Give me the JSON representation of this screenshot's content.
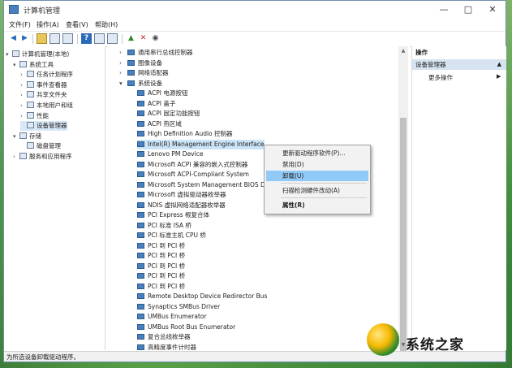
{
  "window": {
    "title": "计算机管理"
  },
  "menu": [
    "文件(F)",
    "操作(A)",
    "查看(V)",
    "帮助(H)"
  ],
  "left_tree": [
    {
      "label": "计算机管理(本地)",
      "indent": 0,
      "arrow": "▾"
    },
    {
      "label": "系统工具",
      "indent": 1,
      "arrow": "▾"
    },
    {
      "label": "任务计划程序",
      "indent": 2,
      "arrow": "›"
    },
    {
      "label": "事件查看器",
      "indent": 2,
      "arrow": "›"
    },
    {
      "label": "共享文件夹",
      "indent": 2,
      "arrow": "›"
    },
    {
      "label": "本地用户和组",
      "indent": 2,
      "arrow": "›"
    },
    {
      "label": "性能",
      "indent": 2,
      "arrow": "›"
    },
    {
      "label": "设备管理器",
      "indent": 2,
      "arrow": "",
      "selected": true
    },
    {
      "label": "存储",
      "indent": 1,
      "arrow": "▾"
    },
    {
      "label": "磁盘管理",
      "indent": 2,
      "arrow": ""
    },
    {
      "label": "服务和应用程序",
      "indent": 1,
      "arrow": "›"
    }
  ],
  "device_categories_top": [
    {
      "label": "通用串行总线控制器",
      "arrow": "›"
    },
    {
      "label": "图像设备",
      "arrow": "›"
    },
    {
      "label": "网络适配器",
      "arrow": "›"
    },
    {
      "label": "系统设备",
      "arrow": "▾"
    }
  ],
  "system_devices": [
    "ACPI 电源按钮",
    "ACPI 盖子",
    "ACPI 固定功能按钮",
    "ACPI 热区域",
    "High Definition Audio 控制器",
    "Intel(R) Management Engine Interface",
    "Lenovo PM Device",
    "Microsoft ACPI 兼容的嵌入式控制器",
    "Microsoft ACPI-Compliant System",
    "Microsoft System Management BIOS D",
    "Microsoft 虚拟驱动器枚举器",
    "NDIS 虚拟网络适配器枚举器",
    "PCI Express 根复合体",
    "PCI 标准 ISA 桥",
    "PCI 标准主机 CPU 桥",
    "PCI 到 PCI 桥",
    "PCI 到 PCI 桥",
    "PCI 到 PCI 桥",
    "PCI 到 PCI 桥",
    "PCI 到 PCI 桥",
    "Remote Desktop Device Redirector Bus",
    "Synaptics SMBus Driver",
    "UMBus Enumerator",
    "UMBus Root Bus Enumerator",
    "复合总线枚举器",
    "高精度事件计时器"
  ],
  "context_menu": {
    "items": [
      "更新驱动程序软件(P)...",
      "禁用(D)",
      "卸载(U)",
      "扫描检测硬件改动(A)",
      "属性(R)"
    ]
  },
  "actions_pane": {
    "header": "操作",
    "section": "设备管理器",
    "more": "更多操作"
  },
  "status": "为所选设备卸载驱动程序。",
  "watermark": {
    "text": "系统之家"
  }
}
